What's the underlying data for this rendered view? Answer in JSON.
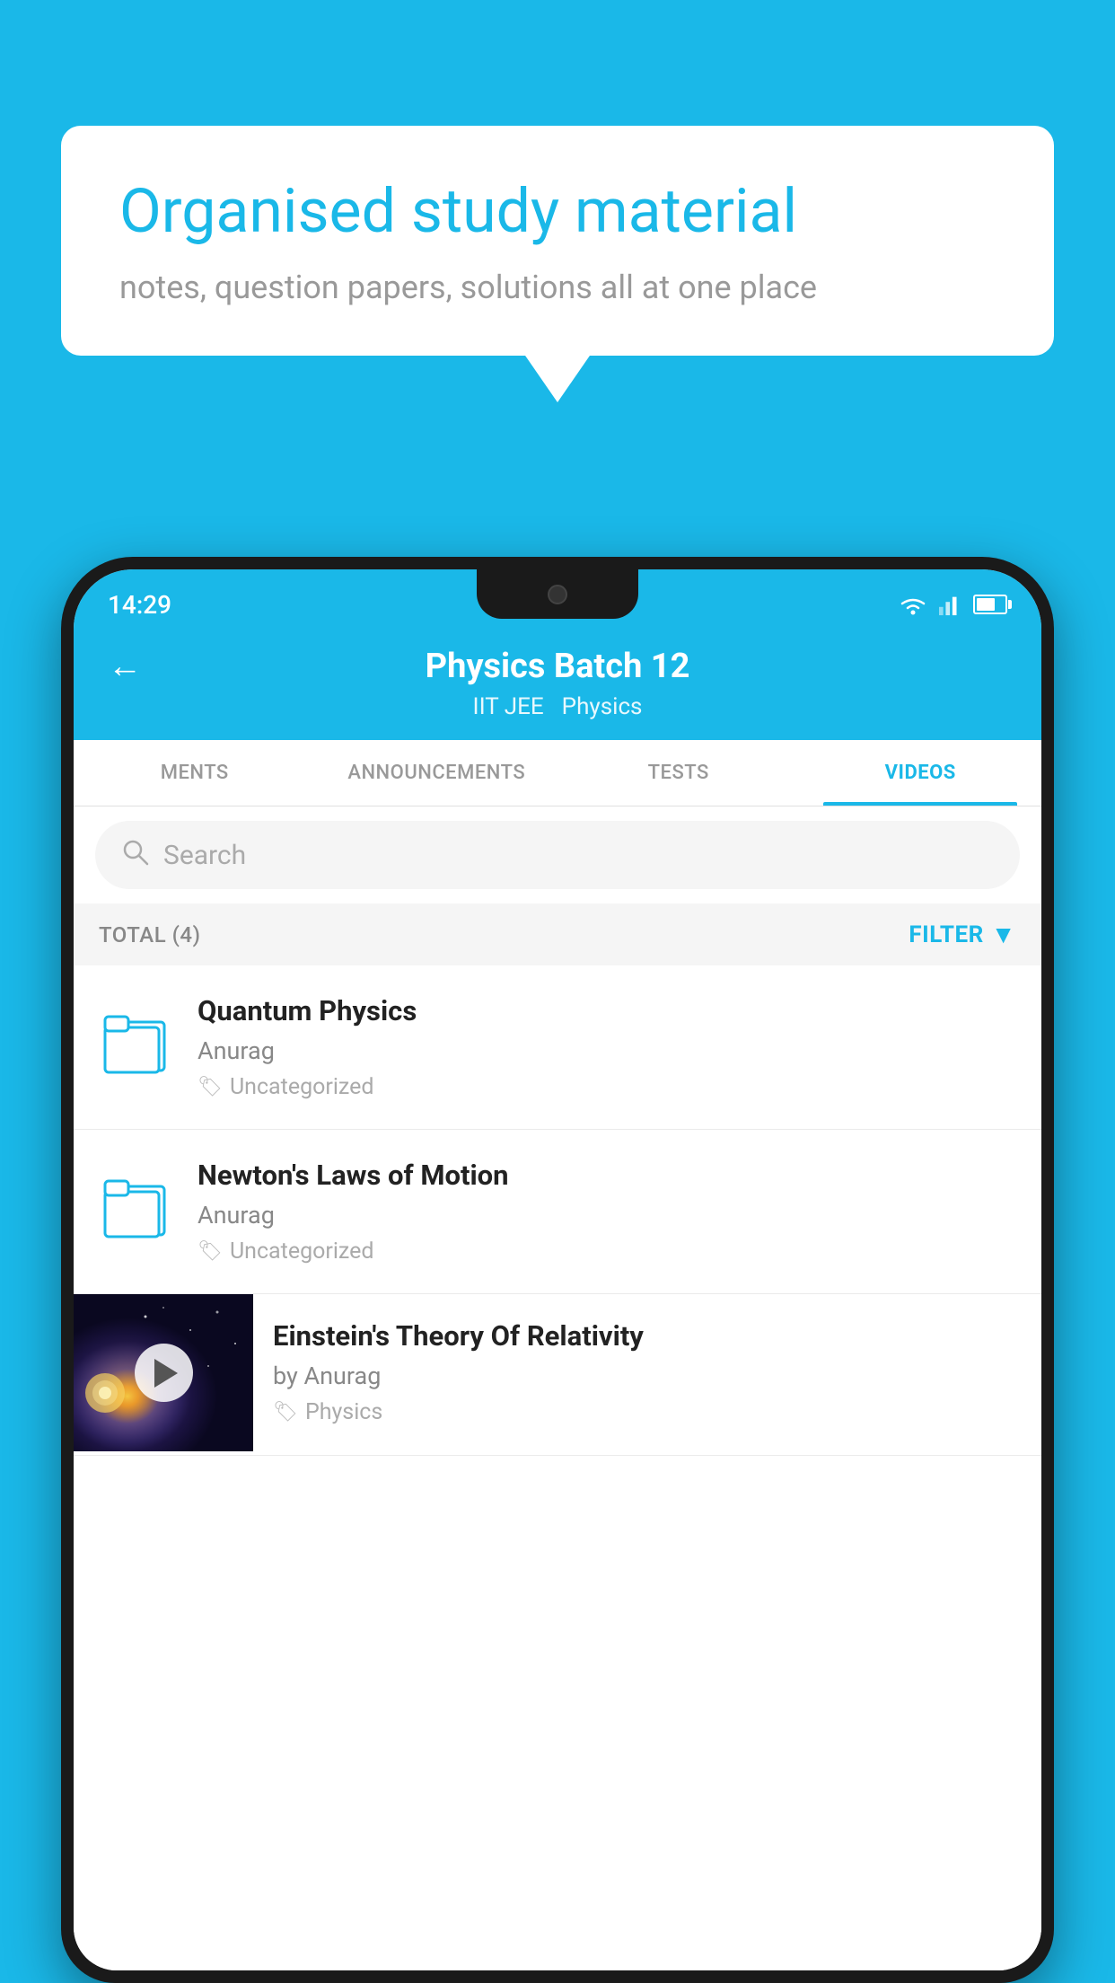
{
  "background_color": "#1ab8e8",
  "bubble": {
    "title": "Organised study material",
    "subtitle": "notes, question papers, solutions all at one place"
  },
  "phone": {
    "status_bar": {
      "time": "14:29"
    },
    "header": {
      "title": "Physics Batch 12",
      "subtitle_tags": [
        "IIT JEE",
        "Physics"
      ],
      "back_label": "←"
    },
    "tabs": [
      {
        "label": "MENTS",
        "active": false
      },
      {
        "label": "ANNOUNCEMENTS",
        "active": false
      },
      {
        "label": "TESTS",
        "active": false
      },
      {
        "label": "VIDEOS",
        "active": true
      }
    ],
    "search": {
      "placeholder": "Search"
    },
    "filter_row": {
      "total_label": "TOTAL (4)",
      "filter_label": "FILTER"
    },
    "videos": [
      {
        "id": "quantum",
        "title": "Quantum Physics",
        "author": "Anurag",
        "tag": "Uncategorized",
        "has_thumbnail": false
      },
      {
        "id": "newton",
        "title": "Newton's Laws of Motion",
        "author": "Anurag",
        "tag": "Uncategorized",
        "has_thumbnail": false
      },
      {
        "id": "einstein",
        "title": "Einstein's Theory Of Relativity",
        "author": "by Anurag",
        "tag": "Physics",
        "has_thumbnail": true
      }
    ]
  }
}
